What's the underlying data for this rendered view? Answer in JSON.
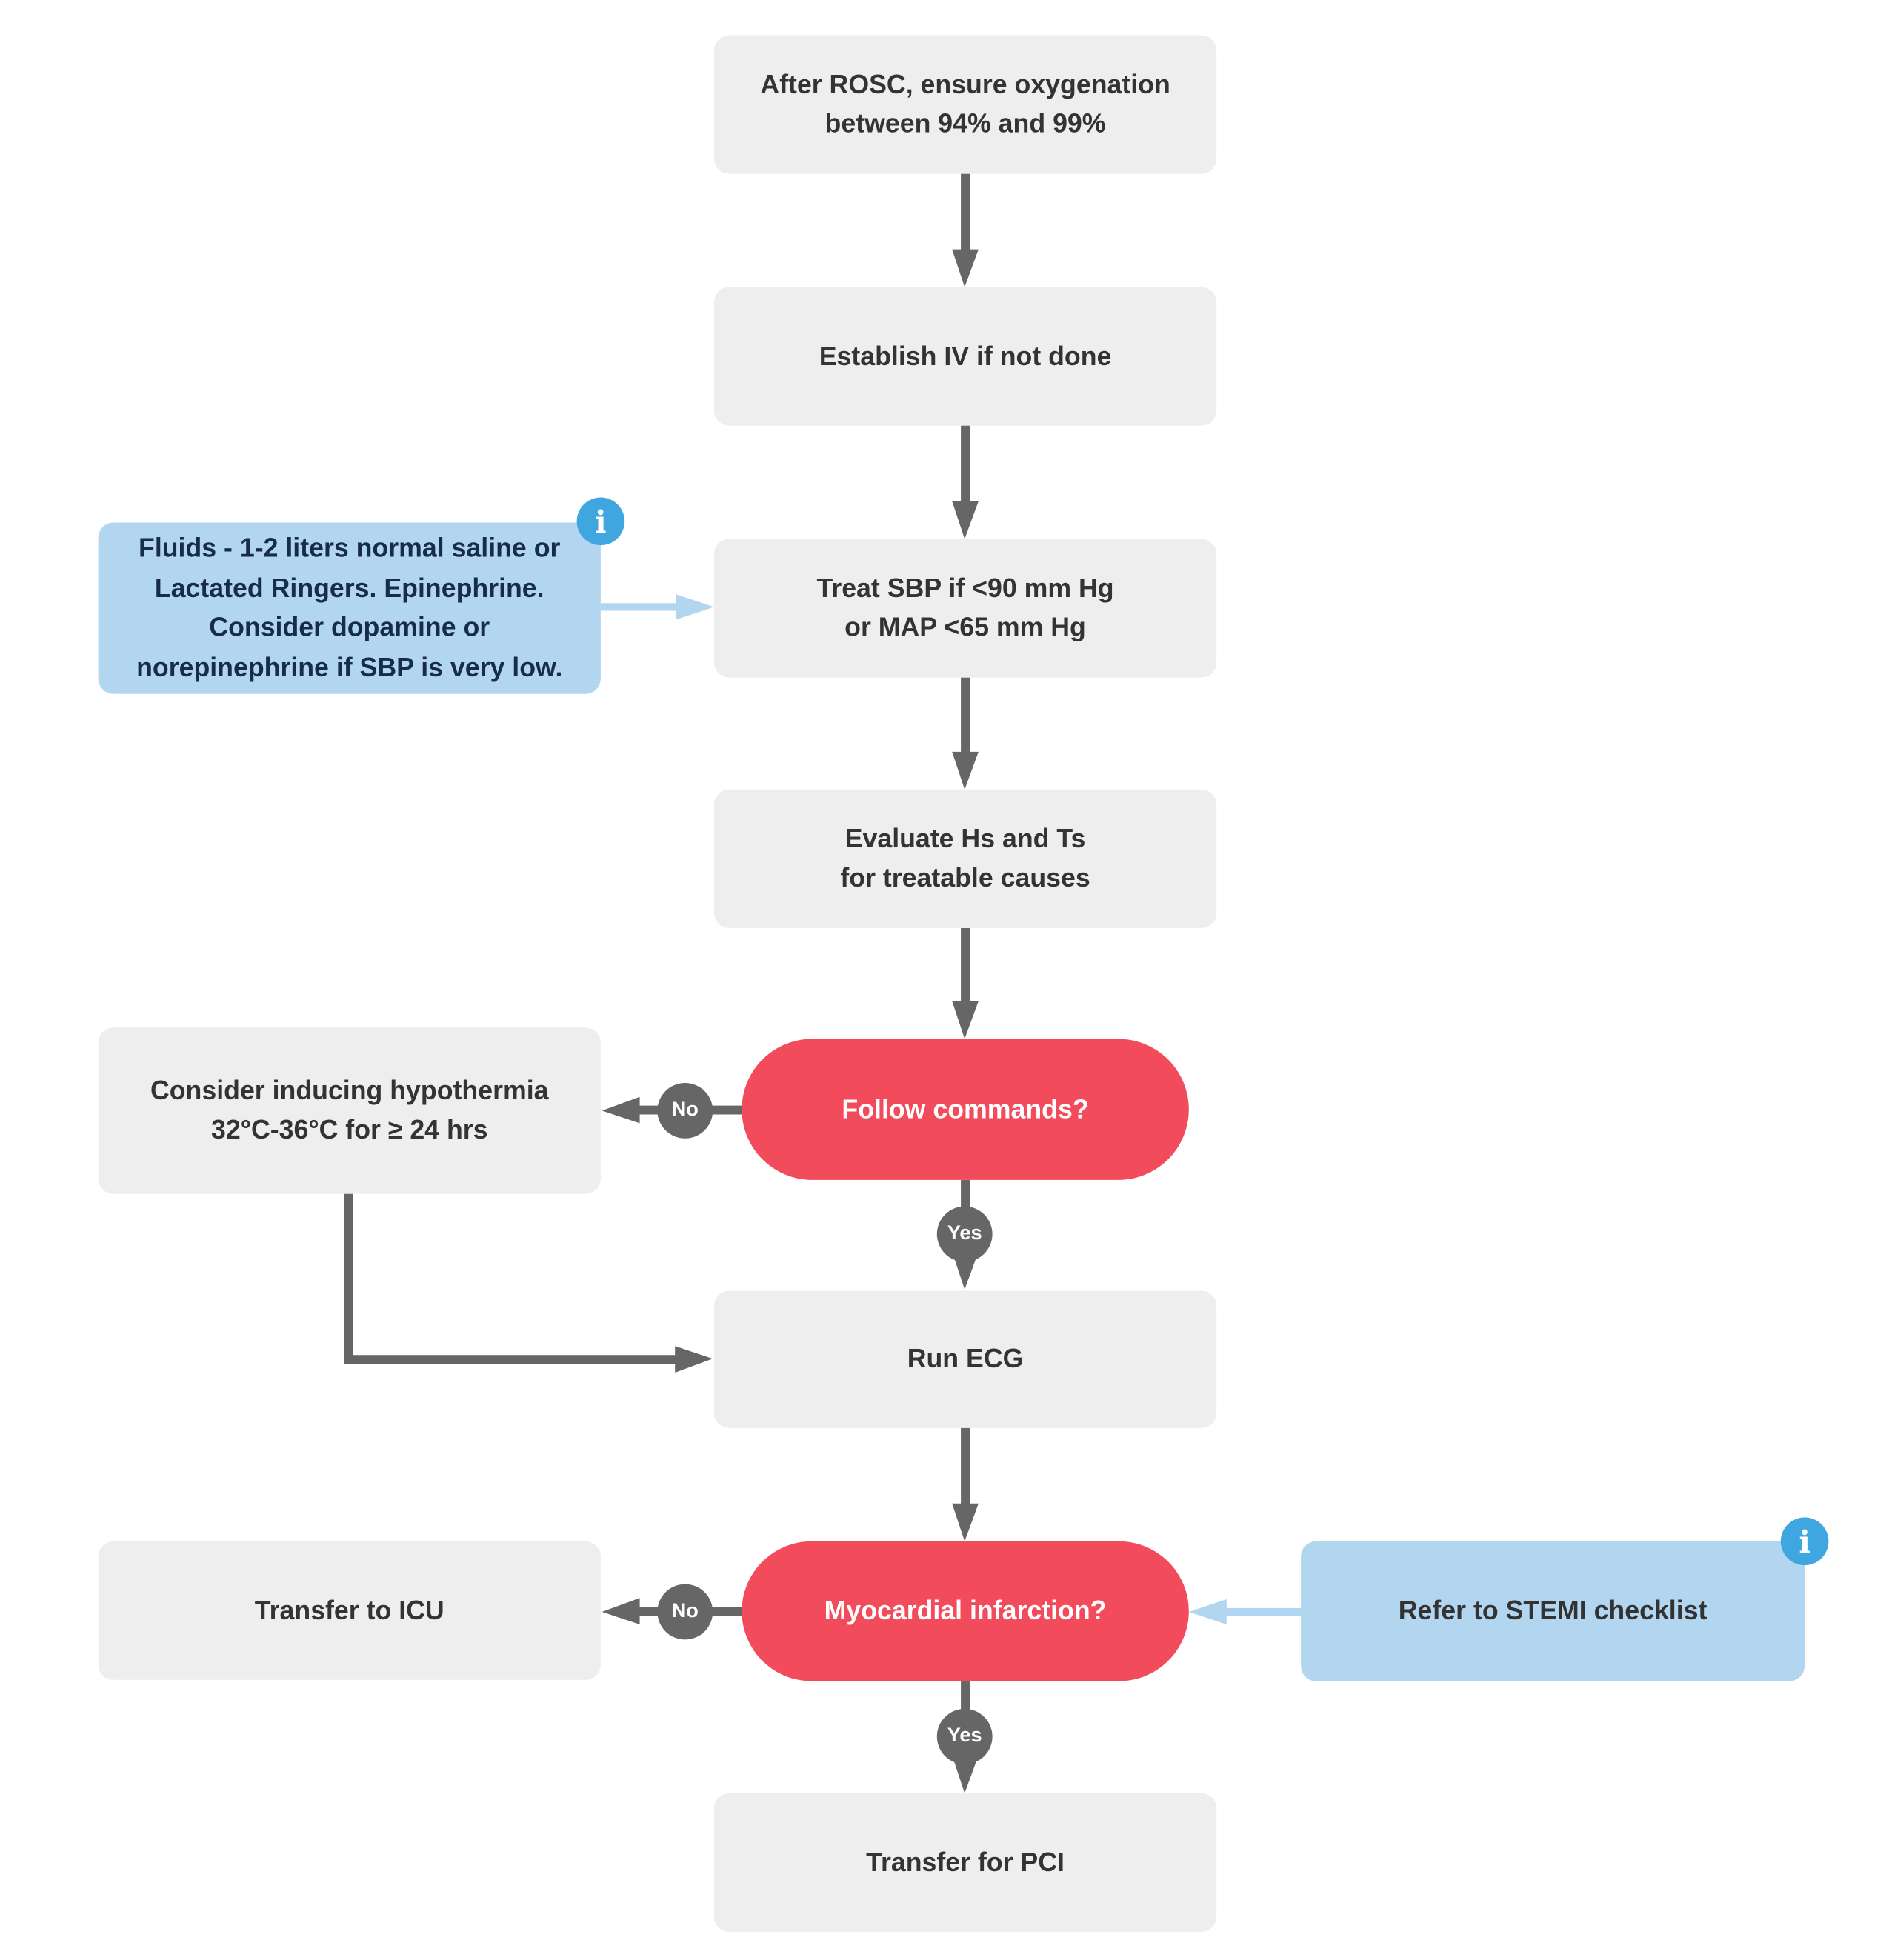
{
  "colors": {
    "process": "#EEEEEE",
    "decision": "#F24C5C",
    "note": "#B3D6F0",
    "info": "#3FA6DF",
    "connector": "#666666",
    "note_connector": "#B3D6F0"
  },
  "nodes": {
    "oxygenation": "After ROSC, ensure oxygenation\nbetween 94% and 99%",
    "establish_iv": "Establish IV if not done",
    "treat_sbp": "Treat SBP if <90 mm Hg\nor MAP <65 mm Hg",
    "evaluate": "Evaluate Hs and Ts\nfor treatable causes",
    "follow_commands": "Follow commands?",
    "hypothermia": "Consider inducing hypothermia\n32°C-36°C for ≥ 24 hrs",
    "run_ecg": "Run ECG",
    "mi": "Myocardial infarction?",
    "icu": "Transfer to ICU",
    "pci": "Transfer for PCI",
    "fluids_note": "Fluids - 1-2 liters normal saline or\nLactated Ringers. Epinephrine.\nConsider dopamine or\nnorepinephrine if SBP is very low.",
    "stemi_note": "Refer to STEMI checklist"
  },
  "labels": {
    "yes": "Yes",
    "no": "No",
    "info_glyph": "i"
  }
}
